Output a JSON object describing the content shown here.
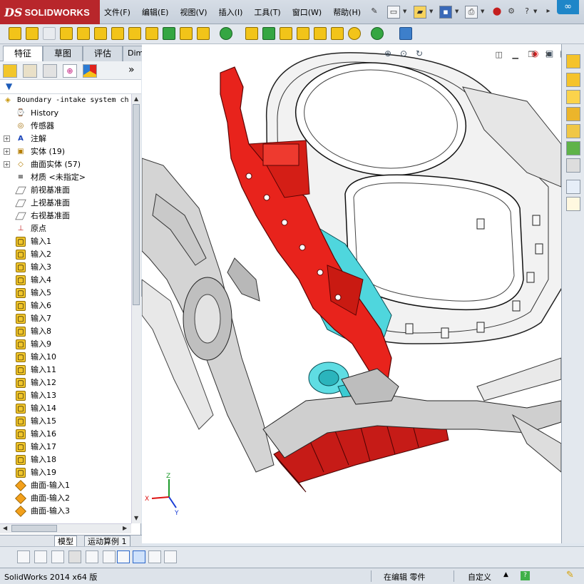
{
  "app": {
    "logo_mark": "DS",
    "logo_text": "SOLIDWORKS",
    "menu": [
      "文件(F)",
      "编辑(E)",
      "视图(V)",
      "插入(I)",
      "工具(T)",
      "窗口(W)",
      "帮助(H)"
    ]
  },
  "sidebar": {
    "tabs": [
      "特征",
      "草图",
      "评估",
      "DimXpert"
    ],
    "active_tab": "特征",
    "tree": [
      {
        "label": "Boundary -intake system ch",
        "icon": "part-icon",
        "level": 0,
        "expand": ""
      },
      {
        "label": "History",
        "icon": "history-icon",
        "level": 1,
        "expand": ""
      },
      {
        "label": "传感器",
        "icon": "sensor-icon",
        "level": 1,
        "expand": ""
      },
      {
        "label": "注解",
        "icon": "annotation-icon",
        "level": 1,
        "expand": "+"
      },
      {
        "label": "实体 (19)",
        "icon": "solid-bodies-icon",
        "level": 1,
        "expand": "+"
      },
      {
        "label": "曲面实体 (57)",
        "icon": "surface-bodies-icon",
        "level": 1,
        "expand": "+"
      },
      {
        "label": "材质 <未指定>",
        "icon": "material-icon",
        "level": 1,
        "expand": ""
      },
      {
        "label": "前视基准面",
        "icon": "plane-icon",
        "level": 1,
        "expand": ""
      },
      {
        "label": "上视基准面",
        "icon": "plane-icon",
        "level": 1,
        "expand": ""
      },
      {
        "label": "右视基准面",
        "icon": "plane-icon",
        "level": 1,
        "expand": ""
      },
      {
        "label": "原点",
        "icon": "origin-icon",
        "level": 1,
        "expand": ""
      },
      {
        "label": "输入1",
        "icon": "import-feature-icon",
        "level": 1,
        "expand": ""
      },
      {
        "label": "输入2",
        "icon": "import-feature-icon",
        "level": 1,
        "expand": ""
      },
      {
        "label": "输入3",
        "icon": "import-feature-icon",
        "level": 1,
        "expand": ""
      },
      {
        "label": "输入4",
        "icon": "import-feature-icon",
        "level": 1,
        "expand": ""
      },
      {
        "label": "输入5",
        "icon": "import-feature-icon",
        "level": 1,
        "expand": ""
      },
      {
        "label": "输入6",
        "icon": "import-feature-icon",
        "level": 1,
        "expand": ""
      },
      {
        "label": "输入7",
        "icon": "import-feature-icon",
        "level": 1,
        "expand": ""
      },
      {
        "label": "输入8",
        "icon": "import-feature-icon",
        "level": 1,
        "expand": ""
      },
      {
        "label": "输入9",
        "icon": "import-feature-icon",
        "level": 1,
        "expand": ""
      },
      {
        "label": "输入10",
        "icon": "import-feature-icon",
        "level": 1,
        "expand": ""
      },
      {
        "label": "输入11",
        "icon": "import-feature-icon",
        "level": 1,
        "expand": ""
      },
      {
        "label": "输入12",
        "icon": "import-feature-icon",
        "level": 1,
        "expand": ""
      },
      {
        "label": "输入13",
        "icon": "import-feature-icon",
        "level": 1,
        "expand": ""
      },
      {
        "label": "输入14",
        "icon": "import-feature-icon",
        "level": 1,
        "expand": ""
      },
      {
        "label": "输入15",
        "icon": "import-feature-icon",
        "level": 1,
        "expand": ""
      },
      {
        "label": "输入16",
        "icon": "import-feature-icon",
        "level": 1,
        "expand": ""
      },
      {
        "label": "输入17",
        "icon": "import-feature-icon",
        "level": 1,
        "expand": ""
      },
      {
        "label": "输入18",
        "icon": "import-feature-icon",
        "level": 1,
        "expand": ""
      },
      {
        "label": "输入19",
        "icon": "import-feature-icon",
        "level": 1,
        "expand": ""
      },
      {
        "label": "曲面-输入1",
        "icon": "surface-import-icon",
        "level": 1,
        "expand": ""
      },
      {
        "label": "曲面-输入2",
        "icon": "surface-import-icon",
        "level": 1,
        "expand": ""
      },
      {
        "label": "曲面-输入3",
        "icon": "surface-import-icon",
        "level": 1,
        "expand": ""
      }
    ]
  },
  "bottom_tabs": [
    "模型",
    "运动算例 1"
  ],
  "status": {
    "product": "SolidWorks 2014 x64 版",
    "mode": "在编辑 零件",
    "units": "自定义"
  },
  "viewport": {
    "triad": {
      "x": "X",
      "y": "Y",
      "z": "Z"
    }
  },
  "colors": {
    "logo_red": "#b8262b",
    "highlight_red": "#e2231a",
    "highlight_cyan": "#33d1d8",
    "body_gray": "#c8c8c8"
  }
}
